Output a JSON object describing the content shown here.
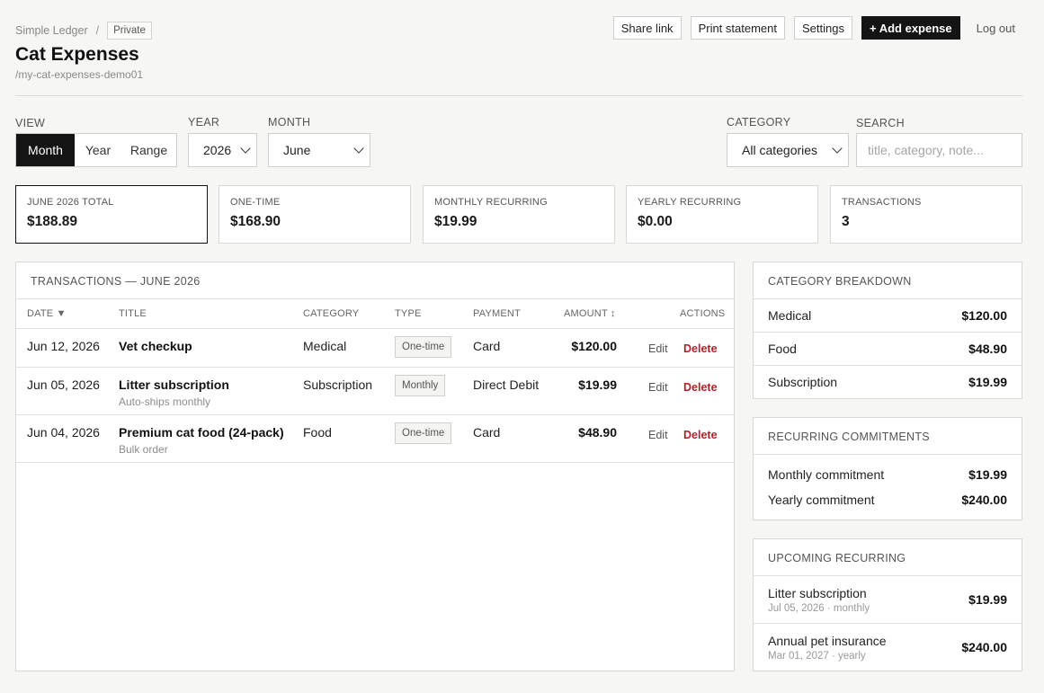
{
  "header": {
    "app_name": "Simple Ledger",
    "separator": "/",
    "visibility_badge": "Private",
    "title": "Cat Expenses",
    "slug": "/my-cat-expenses-demo01",
    "buttons": {
      "share": "Share link",
      "print": "Print statement",
      "settings": "Settings",
      "add": "+ Add expense",
      "logout": "Log out"
    }
  },
  "filters": {
    "view_label": "VIEW",
    "view_options": [
      "Month",
      "Year",
      "Range"
    ],
    "view_selected": "Month",
    "year_label": "YEAR",
    "year_value": "2026",
    "month_label": "MONTH",
    "month_value": "June",
    "category_label": "CATEGORY",
    "category_value": "All categories",
    "search_label": "SEARCH",
    "search_placeholder": "title, category, note..."
  },
  "stats": [
    {
      "label": "JUNE 2026 TOTAL",
      "value": "$188.89"
    },
    {
      "label": "ONE-TIME",
      "value": "$168.90"
    },
    {
      "label": "MONTHLY RECURRING",
      "value": "$19.99"
    },
    {
      "label": "YEARLY RECURRING",
      "value": "$0.00"
    },
    {
      "label": "TRANSACTIONS",
      "value": "3"
    }
  ],
  "transactions": {
    "title": "TRANSACTIONS — JUNE 2026",
    "columns": {
      "date": "DATE ▼",
      "title": "TITLE",
      "category": "CATEGORY",
      "type": "TYPE",
      "payment": "PAYMENT",
      "amount": "AMOUNT ↕",
      "actions": "ACTIONS"
    },
    "edit_label": "Edit",
    "delete_label": "Delete",
    "rows": [
      {
        "date": "Jun 12, 2026",
        "title": "Vet checkup",
        "note": "",
        "category": "Medical",
        "type": "One-time",
        "payment": "Card",
        "amount": "$120.00"
      },
      {
        "date": "Jun 05, 2026",
        "title": "Litter subscription",
        "note": "Auto-ships monthly",
        "category": "Subscription",
        "type": "Monthly",
        "payment": "Direct Debit",
        "amount": "$19.99"
      },
      {
        "date": "Jun 04, 2026",
        "title": "Premium cat food (24-pack)",
        "note": "Bulk order",
        "category": "Food",
        "type": "One-time",
        "payment": "Card",
        "amount": "$48.90"
      }
    ]
  },
  "category_breakdown": {
    "title": "CATEGORY BREAKDOWN",
    "items": [
      {
        "name": "Medical",
        "value": "$120.00"
      },
      {
        "name": "Food",
        "value": "$48.90"
      },
      {
        "name": "Subscription",
        "value": "$19.99"
      }
    ]
  },
  "recurring_commitments": {
    "title": "RECURRING COMMITMENTS",
    "items": [
      {
        "name": "Monthly commitment",
        "value": "$19.99"
      },
      {
        "name": "Yearly commitment",
        "value": "$240.00"
      }
    ]
  },
  "upcoming_recurring": {
    "title": "UPCOMING RECURRING",
    "items": [
      {
        "name": "Litter subscription",
        "detail": "Jul 05, 2026 · monthly",
        "value": "$19.99"
      },
      {
        "name": "Annual pet insurance",
        "detail": "Mar 01, 2027 · yearly",
        "value": "$240.00"
      }
    ]
  }
}
